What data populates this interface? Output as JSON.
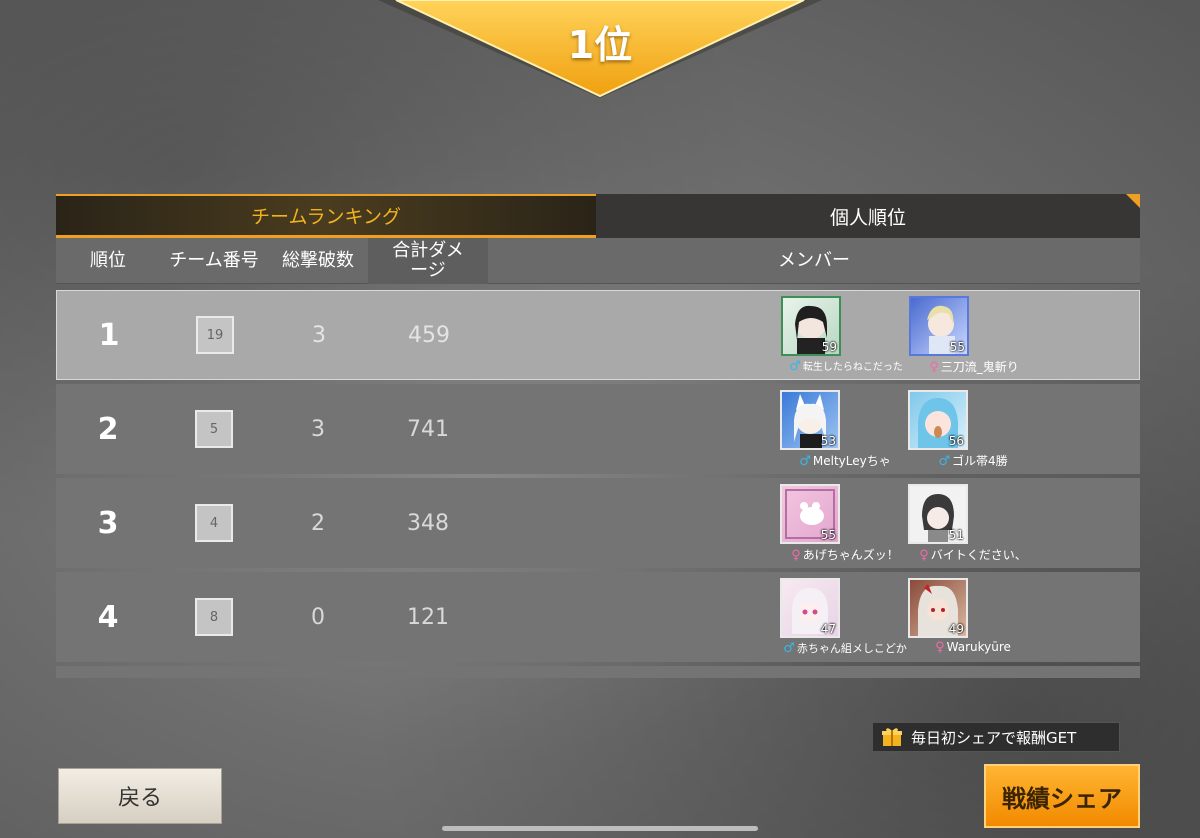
{
  "result": {
    "rank_title": "1位"
  },
  "tabs": {
    "team": "チームランキング",
    "personal": "個人順位"
  },
  "columns": {
    "rank": "順位",
    "team_no": "チーム番号",
    "kills": "総撃破数",
    "damage": "合計ダメージ",
    "members": "メンバー"
  },
  "rows": [
    {
      "rank": "1",
      "team_no": "19",
      "kills": "3",
      "damage": "459",
      "members": [
        {
          "level": "59",
          "gender": "♂",
          "name": "転生したらねこだった"
        },
        {
          "level": "55",
          "gender": "♀",
          "name": "三刀流_鬼斬り"
        }
      ]
    },
    {
      "rank": "2",
      "team_no": "5",
      "kills": "3",
      "damage": "741",
      "members": [
        {
          "level": "53",
          "gender": "♂",
          "name": "MeltyLeyちゃ"
        },
        {
          "level": "56",
          "gender": "♂",
          "name": "ゴル帯4勝"
        }
      ]
    },
    {
      "rank": "3",
      "team_no": "4",
      "kills": "2",
      "damage": "348",
      "members": [
        {
          "level": "55",
          "gender": "♀",
          "name": "あげちゃんズッ！"
        },
        {
          "level": "51",
          "gender": "♀",
          "name": "バイトください、"
        }
      ]
    },
    {
      "rank": "4",
      "team_no": "8",
      "kills": "0",
      "damage": "121",
      "members": [
        {
          "level": "47",
          "gender": "♂",
          "name": "赤ちゃん組メしこどか"
        },
        {
          "level": "49",
          "gender": "♀",
          "name": "Warukyūre"
        }
      ]
    }
  ],
  "gift_note": "毎日初シェアで報酬GET",
  "buttons": {
    "back": "戻る",
    "share": "戦績シェア"
  },
  "colors": {
    "accent": "#f0a020",
    "male": "#37b8e8",
    "female": "#f06aa8"
  },
  "icons": [
    "gift-icon",
    "male-icon",
    "female-icon"
  ]
}
